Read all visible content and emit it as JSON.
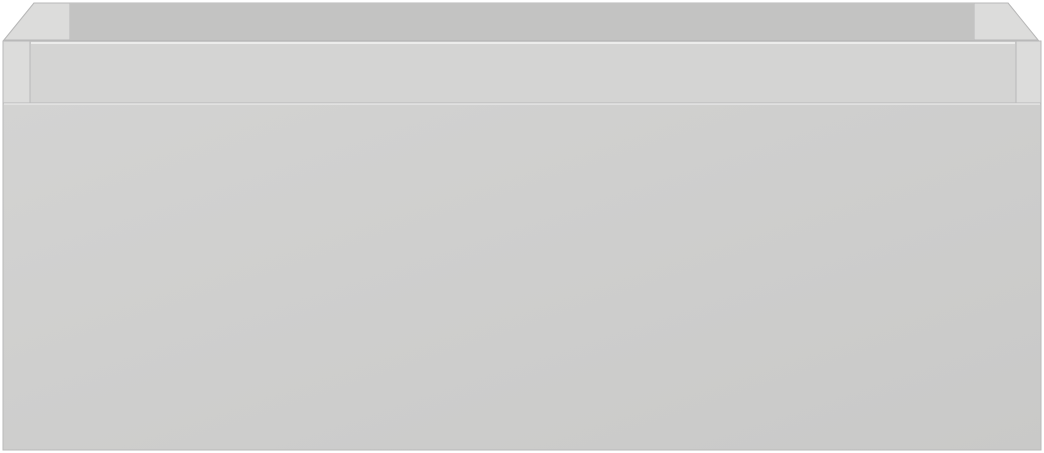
{
  "scene": {
    "subject": "drawer-unit",
    "colors": {
      "background": "#ffffff",
      "outline": "#b9b9b9",
      "front_top": "#d3d3d2",
      "front_bottom": "#c9c9c8",
      "rail": "#d4d4d3",
      "rail_shadow": "#c4c4c3",
      "inner_back": "#c0c0bf",
      "inner_floor": "#cfcfce",
      "side_wall": "#dcdcdb",
      "highlight": "#ececeb"
    }
  }
}
